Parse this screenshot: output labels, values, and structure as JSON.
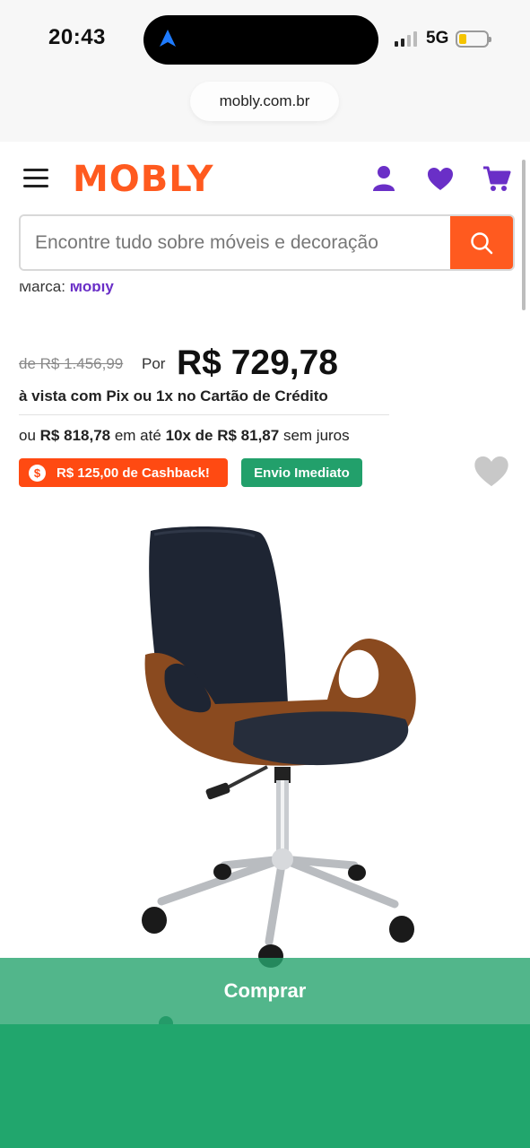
{
  "status_bar": {
    "time": "20:43",
    "network": "5G",
    "icons": [
      "navigation-arrow-icon",
      "signal-icon",
      "battery-icon"
    ]
  },
  "browser": {
    "url": "mobly.com.br"
  },
  "header": {
    "logo": "MOBLY",
    "icons": [
      "menu-icon",
      "user-icon",
      "heart-icon",
      "cart-icon"
    ],
    "accent_color": "#ff5a1f",
    "icon_color": "#6a2fc7"
  },
  "search": {
    "placeholder": "Encontre tudo sobre móveis e decoração",
    "button_icon": "search-icon"
  },
  "product": {
    "brand_label": "Marca:",
    "brand_name": "Mobly",
    "old_price": "de R$ 1.456,99",
    "por_label": "Por",
    "price": "R$ 729,78",
    "pix_note": "à vista com Pix ou 1x no Cartão de Crédito",
    "installment": {
      "prefix": "ou",
      "total": "R$ 818,78",
      "middle": "em até",
      "plan": "10x de R$ 81,87",
      "suffix": "sem juros"
    },
    "cashback_badge": "R$ 125,00 de Cashback!",
    "cashback_coin": "$",
    "shipping_badge": "Envio Imediato",
    "image_alt": "Cadeira de escritório giratória com estrutura em madeira e assento preto",
    "carousel": {
      "total": 7,
      "active": 0
    }
  },
  "actions": {
    "buy_label": "Comprar",
    "buy_color": "#22a06b"
  }
}
